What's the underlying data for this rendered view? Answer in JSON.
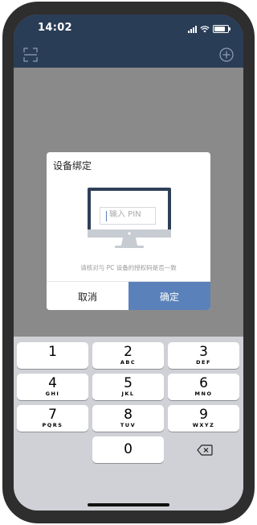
{
  "status_bar": {
    "time": "14:02"
  },
  "dialog": {
    "title": "设备绑定",
    "pin_placeholder": "输入 PIN",
    "hint": "请核对与 PC 设备的授权码是否一致",
    "cancel_label": "取消",
    "confirm_label": "确定"
  },
  "keyboard": {
    "keys": [
      {
        "number": "1",
        "letters": ""
      },
      {
        "number": "2",
        "letters": "ABC"
      },
      {
        "number": "3",
        "letters": "DEF"
      },
      {
        "number": "4",
        "letters": "GHI"
      },
      {
        "number": "5",
        "letters": "JKL"
      },
      {
        "number": "6",
        "letters": "MNO"
      },
      {
        "number": "7",
        "letters": "PQRS"
      },
      {
        "number": "8",
        "letters": "TUV"
      },
      {
        "number": "9",
        "letters": "WXYZ"
      },
      {
        "number": "0",
        "letters": ""
      }
    ]
  },
  "colors": {
    "header": "#2a3d57",
    "overlay": "#8a8a8a",
    "accent": "#5a81ba",
    "keyboard_bg": "#cfd1d6"
  },
  "icons": {
    "scan": "scan-icon",
    "add": "add-circle-icon",
    "monitor": "monitor-icon",
    "backspace": "backspace-icon"
  }
}
